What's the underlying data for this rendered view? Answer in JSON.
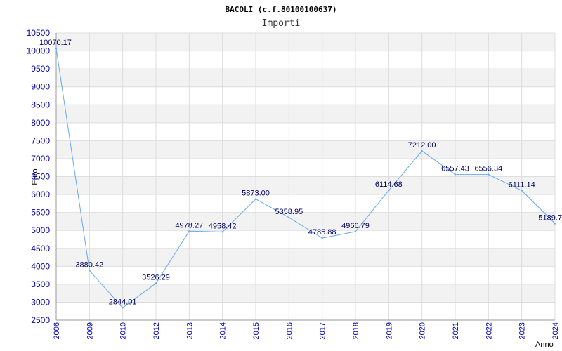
{
  "chart_data": {
    "type": "line",
    "title": "BACOLI (c.f.80100100637)",
    "subtitle": "Importi",
    "xlabel": "Anno",
    "ylabel": "Euro",
    "x": [
      "2006",
      "2009",
      "2010",
      "2012",
      "2013",
      "2014",
      "2015",
      "2016",
      "2017",
      "2018",
      "2019",
      "2020",
      "2021",
      "2022",
      "2023",
      "2024"
    ],
    "series": [
      {
        "values": [
          10070.17,
          3880.42,
          2844.01,
          3526.29,
          4978.27,
          4958.42,
          5873.0,
          5358.95,
          4785.88,
          4966.79,
          6114.68,
          7212.0,
          6557.43,
          6556.34,
          6111.14,
          5189.7
        ],
        "labels": [
          "10070.17",
          "3880.42",
          "2844.01",
          "3526.29",
          "4978.27",
          "4958.42",
          "5873.00",
          "5358.95",
          "4785.88",
          "4966.79",
          "6114.68",
          "7212.00",
          "6557.43",
          "6556.34",
          "6111.14",
          "5189.7"
        ]
      }
    ],
    "ylim": [
      2500,
      10500
    ],
    "yticks": [
      "2500",
      "3000",
      "3500",
      "4000",
      "4500",
      "5000",
      "5500",
      "6000",
      "6500",
      "7000",
      "7500",
      "8000",
      "8500",
      "9000",
      "9500",
      "10000",
      "10500"
    ],
    "grid": true,
    "colors": {
      "line": "#66aaee",
      "band_alt": "#f2f2f2",
      "gridline": "#dddddd",
      "tick_text": "#0000aa",
      "label_text": "#000066"
    }
  }
}
